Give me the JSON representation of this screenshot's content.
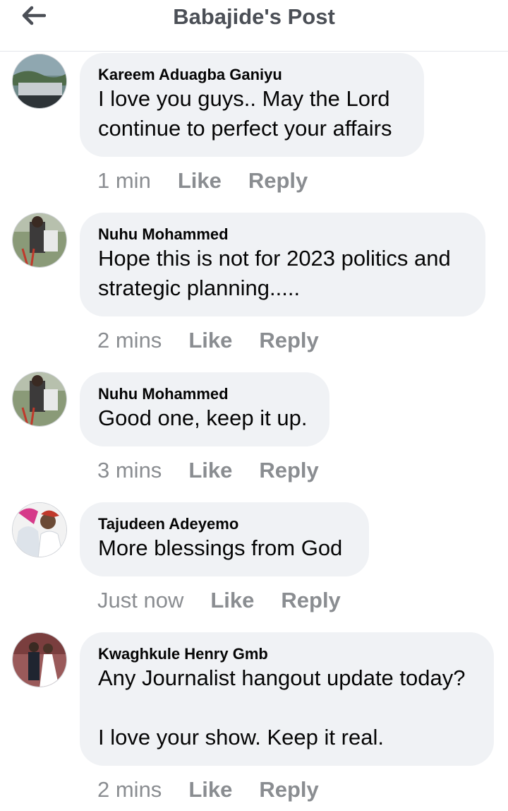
{
  "header": {
    "title": "Babajide's Post",
    "back_icon": "arrow-left-icon"
  },
  "comments": [
    {
      "author": "Kareem Aduagba Ganiyu",
      "text": "I love you guys.. May the Lord\ncontinue to perfect your affairs",
      "time": "1 min",
      "like": "Like",
      "reply": "Reply"
    },
    {
      "author": "Nuhu Mohammed",
      "text": "Hope this is not for 2023 politics and\nstrategic planning.....",
      "time": "2 mins",
      "like": "Like",
      "reply": "Reply"
    },
    {
      "author": "Nuhu Mohammed",
      "text": "Good one, keep it up.",
      "time": "3 mins",
      "like": "Like",
      "reply": "Reply"
    },
    {
      "author": "Tajudeen Adeyemo",
      "text": "More blessings from God",
      "time": "Just now",
      "like": "Like",
      "reply": "Reply"
    },
    {
      "author": "Kwaghkule Henry Gmb",
      "text": "Any Journalist hangout update today?\n\nI love your show. Keep it real.",
      "time": "2 mins",
      "like": "Like",
      "reply": "Reply"
    }
  ],
  "colors": {
    "bubble": "#f0f2f5",
    "meta": "#8a8d91",
    "title": "#4b4f56"
  }
}
